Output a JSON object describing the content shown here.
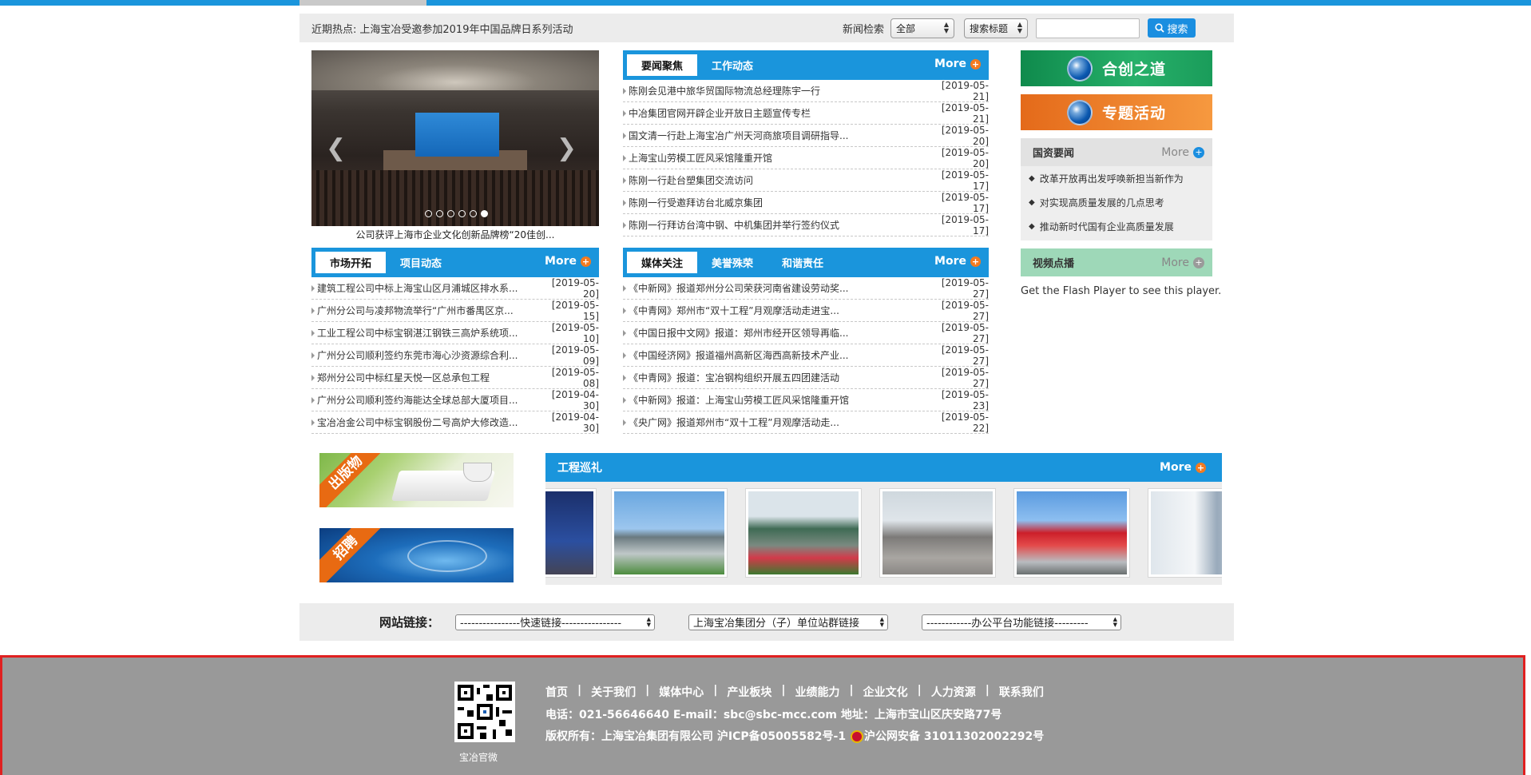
{
  "hotbar": {
    "label": "近期热点:",
    "text": "上海宝冶受邀参加2019年中国品牌日系列活动",
    "search_label": "新闻检索",
    "select1": "全部",
    "select2": "搜索标题",
    "search_button": "搜索"
  },
  "slideshow": {
    "caption": "公司获评上海市企业文化创新品牌榜“20佳创...",
    "dots": 6,
    "active_dot": 6
  },
  "news_panel": {
    "tabs": [
      "要闻聚焦",
      "工作动态"
    ],
    "more": "More",
    "items": [
      {
        "title": "陈刚会见港中旅华贸国际物流总经理陈宇一行",
        "date": "[2019-05-21]"
      },
      {
        "title": "中冶集团官网开辟企业开放日主题宣传专栏",
        "date": "[2019-05-21]"
      },
      {
        "title": "国文清一行赴上海宝冶广州天河商旅项目调研指导...",
        "date": "[2019-05-20]"
      },
      {
        "title": "上海宝山劳模工匠风采馆隆重开馆",
        "date": "[2019-05-20]"
      },
      {
        "title": "陈刚一行赴台塑集团交流访问",
        "date": "[2019-05-17]"
      },
      {
        "title": "陈刚一行受邀拜访台北威京集团",
        "date": "[2019-05-17]"
      },
      {
        "title": "陈刚一行拜访台湾中钢、中机集团并举行签约仪式",
        "date": "[2019-05-17]"
      }
    ]
  },
  "market_panel": {
    "tabs": [
      "市场开拓",
      "项目动态"
    ],
    "more": "More",
    "items": [
      {
        "title": "建筑工程公司中标上海宝山区月浦城区排水系...",
        "date": "[2019-05-20]"
      },
      {
        "title": "广州分公司与凌邦物流举行“广州市番禺区京...",
        "date": "[2019-05-15]"
      },
      {
        "title": "工业工程公司中标宝钢湛江钢铁三高炉系统项...",
        "date": "[2019-05-10]"
      },
      {
        "title": "广州分公司顺利签约东莞市海心沙资源综合利...",
        "date": "[2019-05-09]"
      },
      {
        "title": "郑州分公司中标红星天悦一区总承包工程",
        "date": "[2019-05-08]"
      },
      {
        "title": "广州分公司顺利签约海能达全球总部大厦项目...",
        "date": "[2019-04-30]"
      },
      {
        "title": "宝冶冶金公司中标宝钢股份二号高炉大修改造...",
        "date": "[2019-04-30]"
      }
    ]
  },
  "media_panel": {
    "tabs": [
      "媒体关注",
      "美誉殊荣",
      "和谐责任"
    ],
    "more": "More",
    "items": [
      {
        "title": "《中新网》报道郑州分公司荣获河南省建设劳动奖...",
        "date": "[2019-05-27]"
      },
      {
        "title": "《中青网》郑州市“双十工程”月观摩活动走进宝...",
        "date": "[2019-05-27]"
      },
      {
        "title": "《中国日报中文网》报道：郑州市经开区领导再临...",
        "date": "[2019-05-27]"
      },
      {
        "title": "《中国经济网》报道福州高新区海西高新技术产业...",
        "date": "[2019-05-27]"
      },
      {
        "title": "《中青网》报道：宝冶钢构组织开展五四团建活动",
        "date": "[2019-05-27]"
      },
      {
        "title": "《中新网》报道：上海宝山劳模工匠风采馆隆重开馆",
        "date": "[2019-05-23]"
      },
      {
        "title": "《央广网》报道郑州市“双十工程”月观摩活动走...",
        "date": "[2019-05-22]"
      }
    ]
  },
  "right": {
    "btn1": "合创之道",
    "btn2": "专题活动",
    "guozi_title": "国资要闻",
    "guozi_more": "More",
    "guozi_items": [
      "改革开放再出发呼唤新担当新作为",
      "对实现高质量发展的几点思考",
      "推动新时代国有企业高质量发展"
    ],
    "video_title": "视频点播",
    "video_more": "More",
    "flash_text": "Get the Flash Player to see this player."
  },
  "promo": {
    "pub_label": "出版物",
    "recruit_label": "招聘"
  },
  "gallery": {
    "title": "工程巡礼",
    "more": "More"
  },
  "links": {
    "label": "网站链接：",
    "select1": "----------------快速链接----------------",
    "select2": "上海宝冶集团分（子）单位站群链接",
    "select3": "------------办公平台功能链接---------"
  },
  "footer": {
    "nav": [
      "首页",
      "关于我们",
      "媒体中心",
      "产业板块",
      "业绩能力",
      "企业文化",
      "人力资源",
      "联系我们"
    ],
    "contact": "电话：021-56646640   E-mail：sbc@sbc-mcc.com   地址：上海市宝山区庆安路77号",
    "copyright": "版权所有：上海宝冶集团有限公司   沪ICP备05005582号-1",
    "police": "沪公网安备 31011302002292号",
    "qr_label": "宝冶官微"
  },
  "colors": {
    "primary": "#1a95dc",
    "accent": "#f47a1f",
    "footer_bg": "#999999"
  }
}
